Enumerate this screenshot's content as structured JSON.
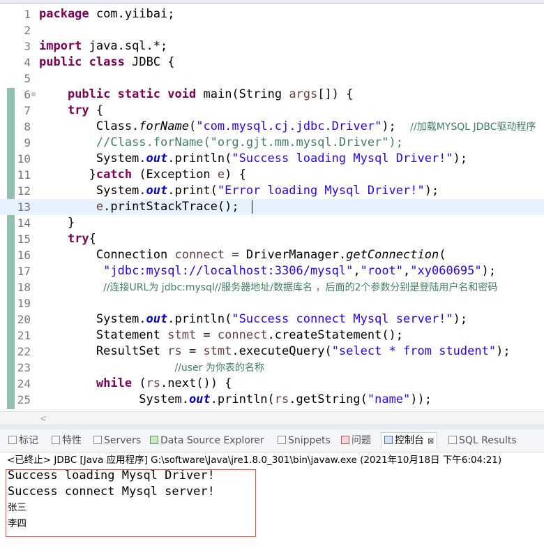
{
  "editor": {
    "lines": [
      {
        "n": "1",
        "parts": [
          {
            "t": "package",
            "c": "kw"
          },
          {
            "t": " com.yiibai;"
          }
        ]
      },
      {
        "n": "2",
        "parts": []
      },
      {
        "n": "3",
        "parts": [
          {
            "t": "import",
            "c": "kw"
          },
          {
            "t": " java.sql.*;"
          }
        ]
      },
      {
        "n": "4",
        "parts": [
          {
            "t": "public",
            "c": "kw"
          },
          {
            "t": " "
          },
          {
            "t": "class",
            "c": "kw"
          },
          {
            "t": " JDBC {"
          }
        ]
      },
      {
        "n": "5",
        "parts": []
      },
      {
        "n": "6",
        "fold": "⊖",
        "parts": [
          {
            "t": "    "
          },
          {
            "t": "public",
            "c": "kw"
          },
          {
            "t": " "
          },
          {
            "t": "static",
            "c": "kw"
          },
          {
            "t": " "
          },
          {
            "t": "void",
            "c": "kw"
          },
          {
            "t": " main(String "
          },
          {
            "t": "args",
            "c": "var"
          },
          {
            "t": "[]) {"
          }
        ]
      },
      {
        "n": "7",
        "parts": [
          {
            "t": "    "
          },
          {
            "t": "try",
            "c": "kw"
          },
          {
            "t": " {"
          }
        ]
      },
      {
        "n": "8",
        "parts": [
          {
            "t": "        Class."
          },
          {
            "t": "forName",
            "c": "it"
          },
          {
            "t": "("
          },
          {
            "t": "\"com.mysql.cj.jdbc.Driver\"",
            "c": "str"
          },
          {
            "t": ");  "
          },
          {
            "t": "//加载MYSQL JDBC驱动程序",
            "c": "cmt"
          }
        ]
      },
      {
        "n": "9",
        "parts": [
          {
            "t": "        "
          },
          {
            "t": "//Class.forName(\"org.gjt.mm.mysql.Driver\");",
            "c": "cmt"
          }
        ]
      },
      {
        "n": "10",
        "parts": [
          {
            "t": "        System."
          },
          {
            "t": "out",
            "c": "fld"
          },
          {
            "t": ".println("
          },
          {
            "t": "\"Success loading Mysql Driver!\"",
            "c": "str"
          },
          {
            "t": ");"
          }
        ]
      },
      {
        "n": "11",
        "parts": [
          {
            "t": "       }"
          },
          {
            "t": "catch",
            "c": "kw"
          },
          {
            "t": " (Exception "
          },
          {
            "t": "e",
            "c": "var"
          },
          {
            "t": ") {"
          }
        ]
      },
      {
        "n": "12",
        "parts": [
          {
            "t": "        System."
          },
          {
            "t": "out",
            "c": "fld"
          },
          {
            "t": ".print("
          },
          {
            "t": "\"Error loading Mysql Driver!\"",
            "c": "str"
          },
          {
            "t": ");"
          }
        ]
      },
      {
        "n": "13",
        "current": true,
        "caret": true,
        "parts": [
          {
            "t": "        "
          },
          {
            "t": "e",
            "c": "var"
          },
          {
            "t": ".printStackTrace();"
          }
        ]
      },
      {
        "n": "14",
        "parts": [
          {
            "t": "    }"
          }
        ]
      },
      {
        "n": "15",
        "parts": [
          {
            "t": "    "
          },
          {
            "t": "try",
            "c": "kw"
          },
          {
            "t": "{"
          }
        ]
      },
      {
        "n": "16",
        "parts": [
          {
            "t": "        Connection "
          },
          {
            "t": "connect",
            "c": "var"
          },
          {
            "t": " = DriverManager."
          },
          {
            "t": "getConnection",
            "c": "it"
          },
          {
            "t": "("
          }
        ]
      },
      {
        "n": "17",
        "parts": [
          {
            "t": "         "
          },
          {
            "t": "\"jdbc:mysql://localhost:3306/mysql\"",
            "c": "str"
          },
          {
            "t": ","
          },
          {
            "t": "\"root\"",
            "c": "str"
          },
          {
            "t": ","
          },
          {
            "t": "\"xy060695\"",
            "c": "str"
          },
          {
            "t": ");"
          }
        ]
      },
      {
        "n": "18",
        "parts": [
          {
            "t": "         "
          },
          {
            "t": "//连接URL为 jdbc:mysql//服务器地址/数据库名 ，后面的2个参数分别是登陆用户名和密码",
            "c": "cmt"
          }
        ]
      },
      {
        "n": "19",
        "parts": []
      },
      {
        "n": "20",
        "parts": [
          {
            "t": "        System."
          },
          {
            "t": "out",
            "c": "fld"
          },
          {
            "t": ".println("
          },
          {
            "t": "\"Success connect Mysql server!\"",
            "c": "str"
          },
          {
            "t": ");"
          }
        ]
      },
      {
        "n": "21",
        "parts": [
          {
            "t": "        Statement "
          },
          {
            "t": "stmt",
            "c": "var"
          },
          {
            "t": " = "
          },
          {
            "t": "connect",
            "c": "var"
          },
          {
            "t": ".createStatement();"
          }
        ]
      },
      {
        "n": "22",
        "parts": [
          {
            "t": "        ResultSet "
          },
          {
            "t": "rs",
            "c": "var"
          },
          {
            "t": " = "
          },
          {
            "t": "stmt",
            "c": "var"
          },
          {
            "t": ".executeQuery("
          },
          {
            "t": "\"select * from student\"",
            "c": "str"
          },
          {
            "t": ");"
          }
        ]
      },
      {
        "n": "23",
        "parts": [
          {
            "t": "                   "
          },
          {
            "t": "//user 为你表的名称",
            "c": "cmt"
          }
        ]
      },
      {
        "n": "24",
        "parts": [
          {
            "t": "        "
          },
          {
            "t": "while",
            "c": "kw"
          },
          {
            "t": " ("
          },
          {
            "t": "rs",
            "c": "var"
          },
          {
            "t": ".next()) {"
          }
        ]
      },
      {
        "n": "25",
        "parts": [
          {
            "t": "              System."
          },
          {
            "t": "out",
            "c": "fld"
          },
          {
            "t": ".println("
          },
          {
            "t": "rs",
            "c": "var"
          },
          {
            "t": ".getString("
          },
          {
            "t": "\"name\"",
            "c": "str"
          },
          {
            "t": "));"
          }
        ]
      }
    ]
  },
  "scroll_arrow": "<",
  "tabs": [
    {
      "label": "标记",
      "icon": "markers-icon"
    },
    {
      "label": "特性",
      "icon": "properties-icon"
    },
    {
      "label": "Servers",
      "icon": "servers-icon"
    },
    {
      "label": "Data Source Explorer",
      "icon": "data-source-icon"
    },
    {
      "label": "Snippets",
      "icon": "snippets-icon"
    },
    {
      "label": "问题",
      "icon": "problems-icon"
    },
    {
      "label": "控制台",
      "icon": "console-icon",
      "active": true,
      "close": "⊠"
    },
    {
      "label": "SQL Results",
      "icon": "sql-results-icon"
    }
  ],
  "status": "<已终止> JDBC [Java 应用程序] G:\\software\\Java\\jre1.8.0_301\\bin\\javaw.exe  (2021年10月18日 下午6:04:21)",
  "console_output": [
    "Success loading Mysql Driver!",
    "Success connect Mysql server!",
    "张三",
    "李四"
  ],
  "colors": {
    "keyword": "#7f0055",
    "string": "#2a00ff",
    "comment": "#3f7f5f",
    "field": "#0000c0",
    "highlight_box": "#d9534f"
  }
}
